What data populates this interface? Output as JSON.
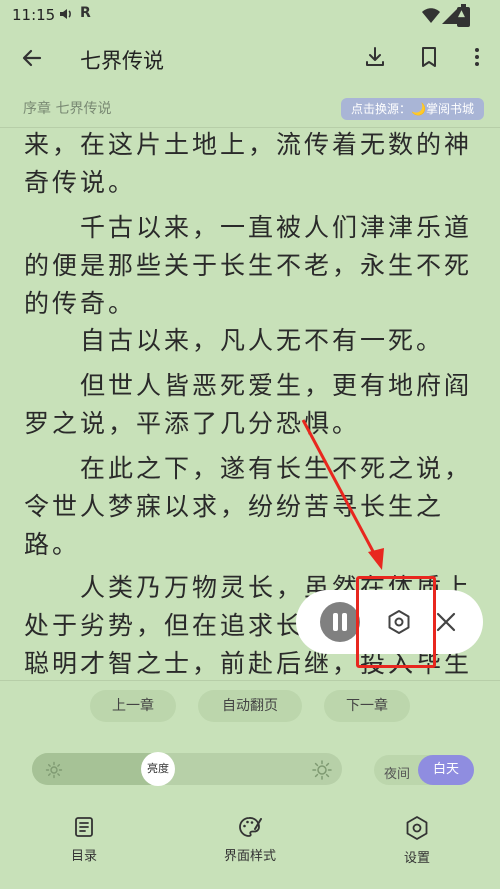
{
  "status_bar": {
    "time": "11:15",
    "r_indicator": "R"
  },
  "header": {
    "title": "七界传说"
  },
  "chapter_bar": {
    "chapter": "序章 七界传说",
    "source_badge": "点击换源：🌙掌阅书城"
  },
  "content": {
    "paragraphs": [
      "来，在这片土地上，流传着无数的神奇传说。",
      "　　千古以来，一直被人们津津乐道的便是那些关于长生不老，永生不死的传奇。",
      "　　自古以来，凡人无不有一死。",
      "　　但世人皆恶死爱生，更有地府阎罗之说，平添了几分恐惧。",
      "　　在此之下，遂有长生不死之说，令世人梦寐以求，纷纷苦寻长生之路。",
      "　　人类乃万物灵长，虽然在体质上处于劣势，但在追求长生途中，无数聪明才智之士，前赴后继，投入毕生精力，苦苦钻研。"
    ]
  },
  "chapter_nav": {
    "prev": "上一章",
    "auto": "自动翻页",
    "next": "下一章"
  },
  "brightness": {
    "label": "亮度",
    "level": 0.45
  },
  "theme_mode": {
    "night": "夜间",
    "day": "白天",
    "active": "day"
  },
  "bottom_nav": [
    {
      "label": "目录",
      "icon": "catalog-icon"
    },
    {
      "label": "界面样式",
      "icon": "palette-icon"
    },
    {
      "label": "设置",
      "icon": "settings-icon"
    }
  ],
  "colors": {
    "background": "#c8e1b9",
    "accent": "#8f8de0",
    "highlight": "#e8271f"
  }
}
